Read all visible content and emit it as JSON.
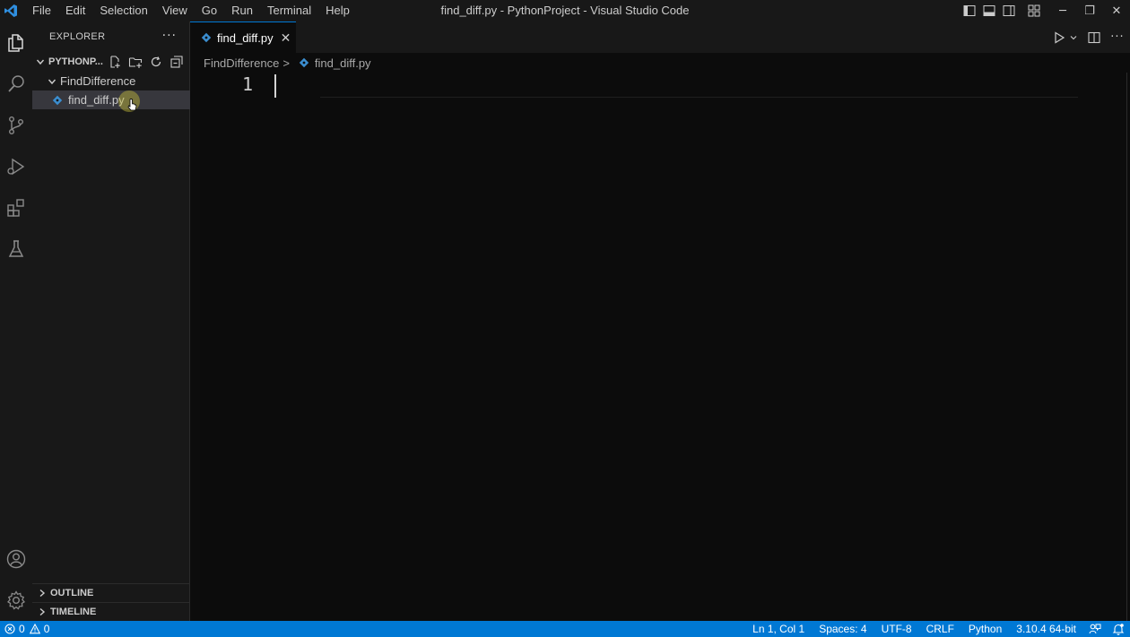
{
  "window": {
    "title": "find_diff.py - PythonProject - Visual Studio Code",
    "minimize": "─",
    "restore": "❐",
    "close": "✕"
  },
  "menu": [
    "File",
    "Edit",
    "Selection",
    "View",
    "Go",
    "Run",
    "Terminal",
    "Help"
  ],
  "sidebar": {
    "header": "EXPLORER",
    "more": "···",
    "project": "PYTHONP...",
    "folder": "FindDifference",
    "file": "find_diff.py",
    "outline": "OUTLINE",
    "timeline": "TIMELINE"
  },
  "editor": {
    "tab_label": "find_diff.py",
    "tab_close": "✕",
    "breadcrumb_folder": "FindDifference",
    "breadcrumb_sep": ">",
    "breadcrumb_file": "find_diff.py",
    "line_number": "1",
    "more": "···"
  },
  "status": {
    "errors": "0",
    "warnings": "0",
    "position": "Ln 1, Col 1",
    "spaces": "Spaces: 4",
    "encoding": "UTF-8",
    "eol": "CRLF",
    "language": "Python",
    "interpreter": "3.10.4 64-bit"
  },
  "colors": {
    "accent": "#0078d4",
    "python_icon": "#3b8ed0",
    "background": "#0c0c0c",
    "chrome": "#181818"
  }
}
